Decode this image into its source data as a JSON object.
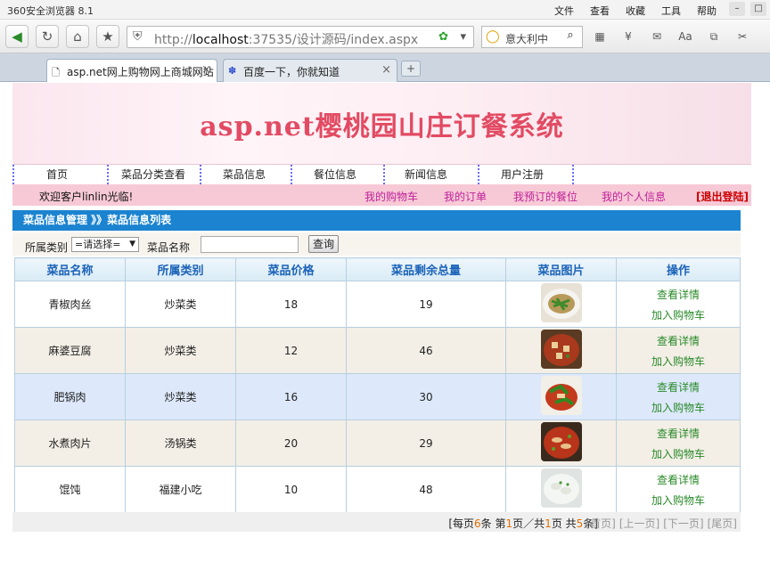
{
  "browser": {
    "app_title": "360安全浏览器 8.1",
    "menus": [
      "文件",
      "查看",
      "收藏",
      "工具",
      "帮助"
    ],
    "url_prefix": "http://",
    "url_host": "localhost",
    "url_rest": ":37535/设计源码/index.aspx",
    "search_text": "意大利中",
    "tabs": [
      {
        "title": "asp.net网上购物网上商城网站",
        "active": true
      },
      {
        "title": "百度一下，你就知道",
        "active": false
      }
    ],
    "newtab_label": "+"
  },
  "site": {
    "banner_title": "asp.net樱桃园山庄订餐系统",
    "nav": [
      "首页",
      "菜品分类查看",
      "菜品信息",
      "餐位信息",
      "新闻信息",
      "用户注册"
    ],
    "welcome": "欢迎客户linlin光临!",
    "user_links": [
      "我的购物车",
      "我的订单",
      "我预订的餐位",
      "我的个人信息"
    ],
    "logout": "[退出登陆]",
    "section_title": "菜品信息管理  》》菜品信息列表",
    "filter": {
      "category_label": "所属类别",
      "category_value": "=请选择=",
      "name_label": "菜品名称",
      "search_button": "查询"
    },
    "table": {
      "headers": [
        "菜品名称",
        "所属类别",
        "菜品价格",
        "菜品剩余总量",
        "菜品图片",
        "操作"
      ],
      "rows": [
        {
          "name": "青椒肉丝",
          "category": "炒菜类",
          "price": "18",
          "stock": "19"
        },
        {
          "name": "麻婆豆腐",
          "category": "炒菜类",
          "price": "12",
          "stock": "46"
        },
        {
          "name": "肥锅肉",
          "category": "炒菜类",
          "price": "16",
          "stock": "30"
        },
        {
          "name": "水煮肉片",
          "category": "汤锅类",
          "price": "20",
          "stock": "29"
        },
        {
          "name": "馄饨",
          "category": "福建小吃",
          "price": "10",
          "stock": "48"
        }
      ],
      "op_detail": "查看详情",
      "op_cart": "加入购物车"
    },
    "pager": {
      "per_page_prefix": "[每页",
      "per_page": "6",
      "per_page_suffix": "条",
      "page_prefix": "第",
      "page_current": "1",
      "page_mid": "页／共",
      "page_total": "1",
      "page_suffix": "页",
      "total_prefix": "共",
      "total": "5",
      "total_suffix": "条]",
      "links": [
        "[首页]",
        "[上一页]",
        "[下一页]",
        "[尾页]"
      ]
    }
  }
}
